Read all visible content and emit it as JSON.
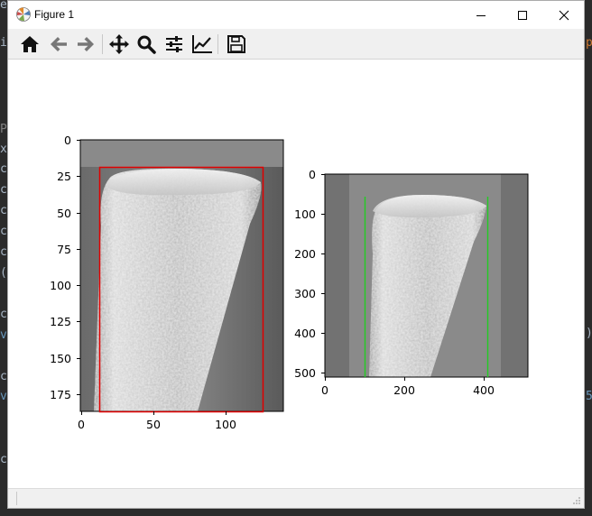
{
  "window": {
    "title": "Figure 1",
    "controls": {
      "minimize": "minimize",
      "maximize": "maximize",
      "close": "close"
    }
  },
  "toolbar": {
    "buttons": [
      {
        "name": "home",
        "icon": "home-icon"
      },
      {
        "name": "back",
        "icon": "arrow-left-icon"
      },
      {
        "name": "forward",
        "icon": "arrow-right-icon"
      },
      {
        "name": "pan",
        "icon": "move-icon"
      },
      {
        "name": "zoom",
        "icon": "magnifier-icon"
      },
      {
        "name": "configure-subplots",
        "icon": "sliders-icon"
      },
      {
        "name": "edit-axis",
        "icon": "line-chart-icon"
      },
      {
        "name": "save",
        "icon": "floppy-disk-icon"
      }
    ]
  },
  "figure": {
    "left_axes": {
      "xticks": [
        "0",
        "50",
        "100"
      ],
      "yticks": [
        "0",
        "25",
        "50",
        "75",
        "100",
        "125",
        "150",
        "175"
      ],
      "rectangle_color": "#e00000"
    },
    "right_axes": {
      "xticks": [
        "0",
        "200",
        "400"
      ],
      "yticks": [
        "0",
        "100",
        "200",
        "300",
        "400",
        "500"
      ],
      "line_color": "#22cc22"
    }
  },
  "background_ghost_text": {
    "left_chars": [
      "e",
      "i",
      "P",
      "x",
      "c",
      "c",
      "c",
      "c",
      "c",
      "(",
      "c",
      "v",
      "c",
      "v",
      "c"
    ],
    "right_chars": [
      "p",
      ")",
      "5"
    ]
  }
}
